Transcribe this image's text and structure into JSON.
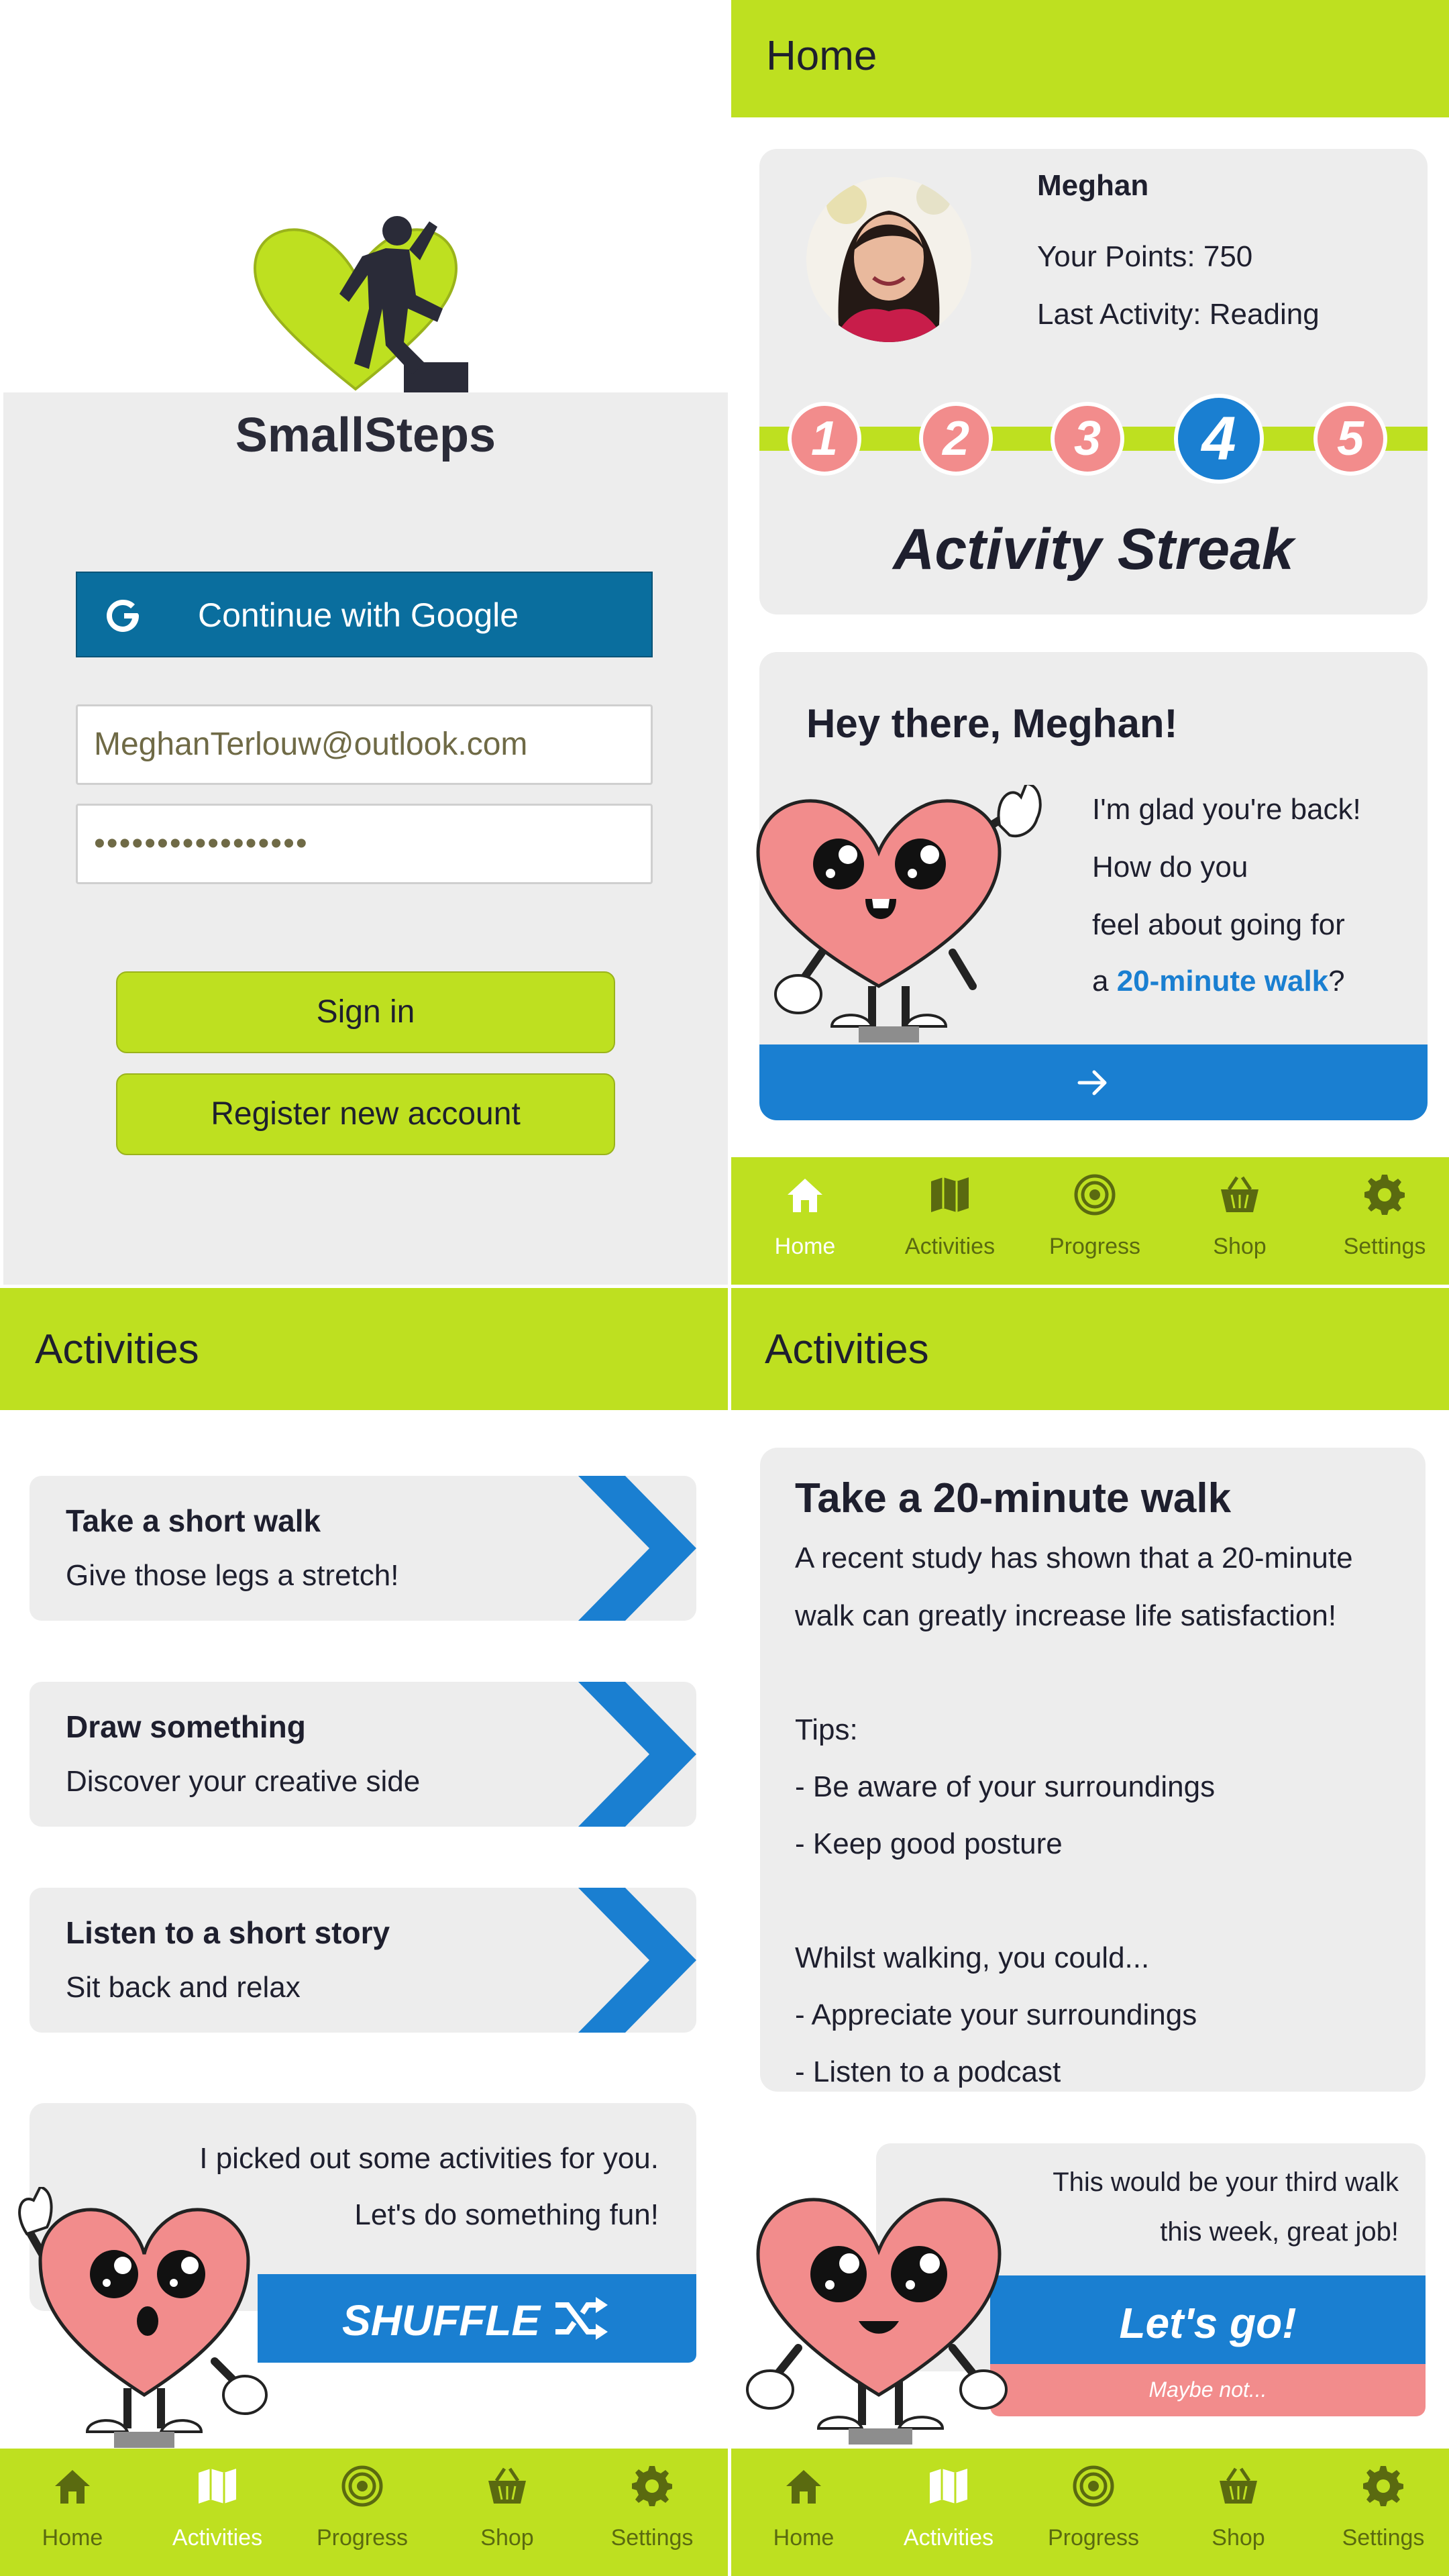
{
  "login": {
    "app_name": "SmallSteps",
    "google_button": "Continue with Google",
    "email_value": "MeghanTerlouw@outlook.com",
    "password_value": "•••••••••••••••••",
    "sign_in": "Sign in",
    "register": "Register new account"
  },
  "home": {
    "header": "Home",
    "profile": {
      "name": "Meghan",
      "points": "Your Points: 750",
      "last_activity": "Last Activity: Reading"
    },
    "streak": {
      "steps": [
        "1",
        "2",
        "3",
        "4",
        "5"
      ],
      "current_step": 4,
      "label": "Activity Streak"
    },
    "greeting": {
      "title": "Hey there, Meghan!",
      "line1": "I'm glad you're back!",
      "line2": "How do you",
      "line3": "feel about going for",
      "line4_prefix": "a ",
      "line4_link": "20-minute walk",
      "line4_suffix": "?"
    }
  },
  "activities_list": {
    "header": "Activities",
    "items": [
      {
        "title": "Take a short walk",
        "subtitle": "Give those legs a stretch!"
      },
      {
        "title": "Draw something",
        "subtitle": "Discover your creative side"
      },
      {
        "title": "Listen to a short story",
        "subtitle": "Sit back and relax"
      }
    ],
    "bubble_line1": "I picked out some activities for you.",
    "bubble_line2": "Let's do something fun!",
    "shuffle": "SHUFFLE"
  },
  "activity_detail": {
    "header": "Activities",
    "title": "Take a 20-minute walk",
    "lines": [
      "A recent study has shown that a 20-minute",
      "walk can greatly increase life satisfaction!",
      "",
      "Tips:",
      "- Be aware of your surroundings",
      "- Keep good posture",
      "",
      "Whilst walking, you could...",
      "- Appreciate your surroundings",
      "- Listen to a podcast"
    ],
    "note_line1": "This would be your third walk",
    "note_line2": "this week, great job!",
    "lets_go": "Let's go!",
    "maybe_not": "Maybe not..."
  },
  "nav": {
    "items": [
      {
        "label": "Home",
        "icon": "home-icon"
      },
      {
        "label": "Activities",
        "icon": "map-icon"
      },
      {
        "label": "Progress",
        "icon": "target-icon"
      },
      {
        "label": "Shop",
        "icon": "basket-icon"
      },
      {
        "label": "Settings",
        "icon": "gear-icon"
      }
    ]
  },
  "colors": {
    "lime": "#bee020",
    "blue": "#1a7fd1",
    "google_blue": "#0a6e9e",
    "coral": "#f28c8c",
    "panel": "#ededed",
    "nav_inactive": "#5a6a10"
  }
}
